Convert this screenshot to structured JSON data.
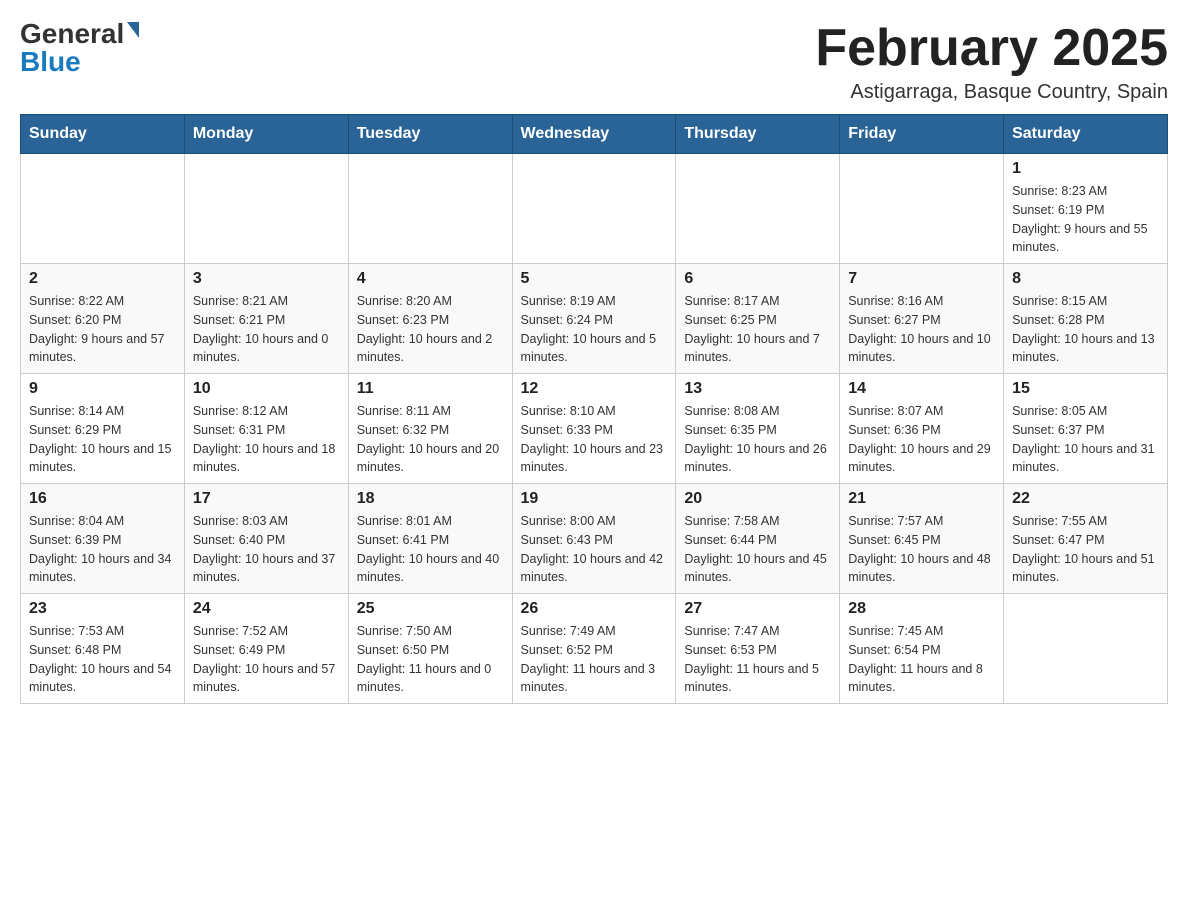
{
  "header": {
    "logo": {
      "general": "General",
      "blue": "Blue",
      "triangle": "▶"
    },
    "title": "February 2025",
    "location": "Astigarraga, Basque Country, Spain"
  },
  "days_of_week": [
    "Sunday",
    "Monday",
    "Tuesday",
    "Wednesday",
    "Thursday",
    "Friday",
    "Saturday"
  ],
  "weeks": [
    {
      "days": [
        {
          "number": "",
          "info": ""
        },
        {
          "number": "",
          "info": ""
        },
        {
          "number": "",
          "info": ""
        },
        {
          "number": "",
          "info": ""
        },
        {
          "number": "",
          "info": ""
        },
        {
          "number": "",
          "info": ""
        },
        {
          "number": "1",
          "info": "Sunrise: 8:23 AM\nSunset: 6:19 PM\nDaylight: 9 hours and 55 minutes."
        }
      ]
    },
    {
      "days": [
        {
          "number": "2",
          "info": "Sunrise: 8:22 AM\nSunset: 6:20 PM\nDaylight: 9 hours and 57 minutes."
        },
        {
          "number": "3",
          "info": "Sunrise: 8:21 AM\nSunset: 6:21 PM\nDaylight: 10 hours and 0 minutes."
        },
        {
          "number": "4",
          "info": "Sunrise: 8:20 AM\nSunset: 6:23 PM\nDaylight: 10 hours and 2 minutes."
        },
        {
          "number": "5",
          "info": "Sunrise: 8:19 AM\nSunset: 6:24 PM\nDaylight: 10 hours and 5 minutes."
        },
        {
          "number": "6",
          "info": "Sunrise: 8:17 AM\nSunset: 6:25 PM\nDaylight: 10 hours and 7 minutes."
        },
        {
          "number": "7",
          "info": "Sunrise: 8:16 AM\nSunset: 6:27 PM\nDaylight: 10 hours and 10 minutes."
        },
        {
          "number": "8",
          "info": "Sunrise: 8:15 AM\nSunset: 6:28 PM\nDaylight: 10 hours and 13 minutes."
        }
      ]
    },
    {
      "days": [
        {
          "number": "9",
          "info": "Sunrise: 8:14 AM\nSunset: 6:29 PM\nDaylight: 10 hours and 15 minutes."
        },
        {
          "number": "10",
          "info": "Sunrise: 8:12 AM\nSunset: 6:31 PM\nDaylight: 10 hours and 18 minutes."
        },
        {
          "number": "11",
          "info": "Sunrise: 8:11 AM\nSunset: 6:32 PM\nDaylight: 10 hours and 20 minutes."
        },
        {
          "number": "12",
          "info": "Sunrise: 8:10 AM\nSunset: 6:33 PM\nDaylight: 10 hours and 23 minutes."
        },
        {
          "number": "13",
          "info": "Sunrise: 8:08 AM\nSunset: 6:35 PM\nDaylight: 10 hours and 26 minutes."
        },
        {
          "number": "14",
          "info": "Sunrise: 8:07 AM\nSunset: 6:36 PM\nDaylight: 10 hours and 29 minutes."
        },
        {
          "number": "15",
          "info": "Sunrise: 8:05 AM\nSunset: 6:37 PM\nDaylight: 10 hours and 31 minutes."
        }
      ]
    },
    {
      "days": [
        {
          "number": "16",
          "info": "Sunrise: 8:04 AM\nSunset: 6:39 PM\nDaylight: 10 hours and 34 minutes."
        },
        {
          "number": "17",
          "info": "Sunrise: 8:03 AM\nSunset: 6:40 PM\nDaylight: 10 hours and 37 minutes."
        },
        {
          "number": "18",
          "info": "Sunrise: 8:01 AM\nSunset: 6:41 PM\nDaylight: 10 hours and 40 minutes."
        },
        {
          "number": "19",
          "info": "Sunrise: 8:00 AM\nSunset: 6:43 PM\nDaylight: 10 hours and 42 minutes."
        },
        {
          "number": "20",
          "info": "Sunrise: 7:58 AM\nSunset: 6:44 PM\nDaylight: 10 hours and 45 minutes."
        },
        {
          "number": "21",
          "info": "Sunrise: 7:57 AM\nSunset: 6:45 PM\nDaylight: 10 hours and 48 minutes."
        },
        {
          "number": "22",
          "info": "Sunrise: 7:55 AM\nSunset: 6:47 PM\nDaylight: 10 hours and 51 minutes."
        }
      ]
    },
    {
      "days": [
        {
          "number": "23",
          "info": "Sunrise: 7:53 AM\nSunset: 6:48 PM\nDaylight: 10 hours and 54 minutes."
        },
        {
          "number": "24",
          "info": "Sunrise: 7:52 AM\nSunset: 6:49 PM\nDaylight: 10 hours and 57 minutes."
        },
        {
          "number": "25",
          "info": "Sunrise: 7:50 AM\nSunset: 6:50 PM\nDaylight: 11 hours and 0 minutes."
        },
        {
          "number": "26",
          "info": "Sunrise: 7:49 AM\nSunset: 6:52 PM\nDaylight: 11 hours and 3 minutes."
        },
        {
          "number": "27",
          "info": "Sunrise: 7:47 AM\nSunset: 6:53 PM\nDaylight: 11 hours and 5 minutes."
        },
        {
          "number": "28",
          "info": "Sunrise: 7:45 AM\nSunset: 6:54 PM\nDaylight: 11 hours and 8 minutes."
        },
        {
          "number": "",
          "info": ""
        }
      ]
    }
  ]
}
